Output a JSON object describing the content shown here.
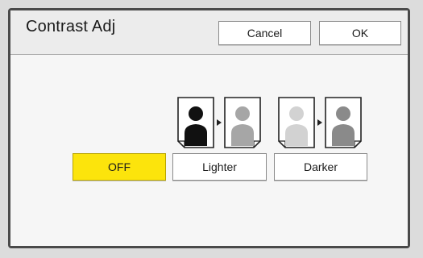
{
  "dialog": {
    "title": "Contrast Adj",
    "cancel_label": "Cancel",
    "ok_label": "OK"
  },
  "options": {
    "off_label": "OFF",
    "lighter_label": "Lighter",
    "darker_label": "Darker",
    "selected": "OFF"
  },
  "colors": {
    "selected_bg": "#fce40c",
    "border": "#4a4a4a"
  },
  "icons": {
    "lighter": "dark-to-light-person-icon",
    "darker": "light-to-dark-person-icon"
  }
}
